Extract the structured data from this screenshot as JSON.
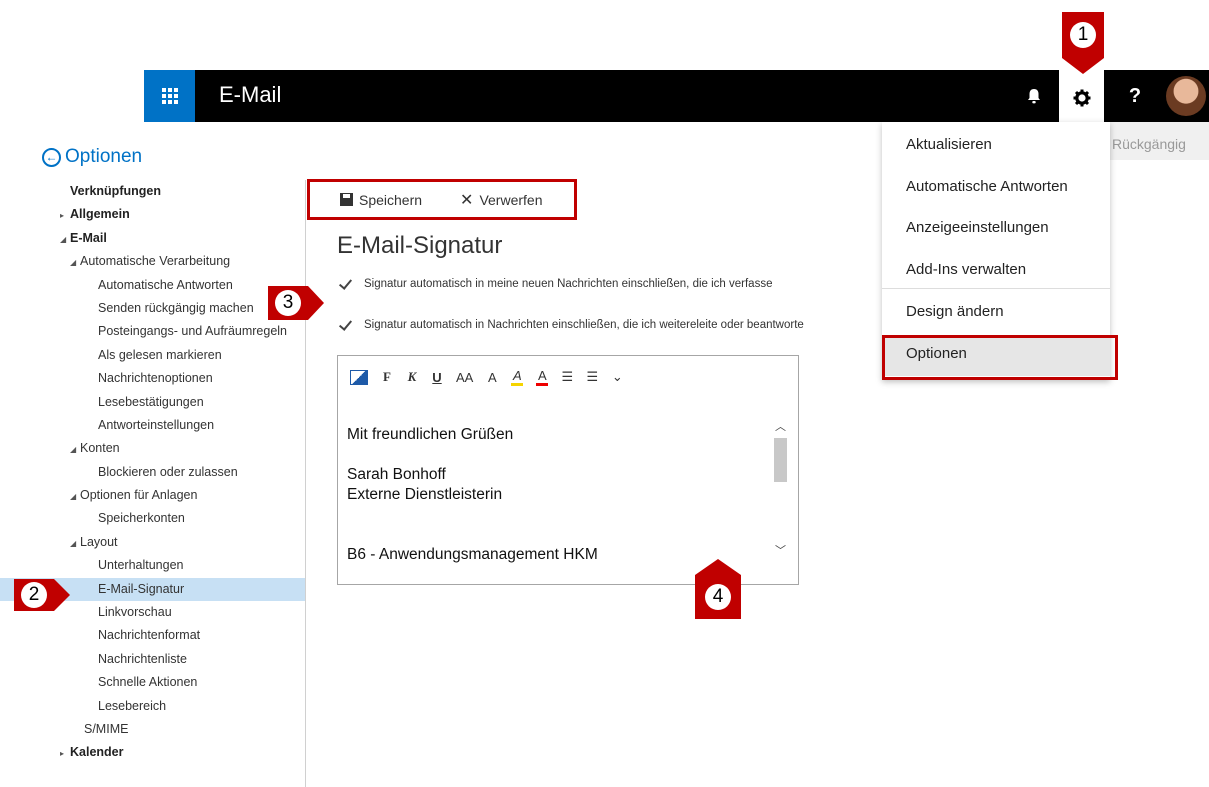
{
  "header": {
    "app_title": "E-Mail",
    "icons": [
      "app-launcher-icon",
      "bell-icon",
      "gear-icon",
      "help-icon",
      "avatar"
    ],
    "help_label": "?"
  },
  "nav": {
    "back_label": "Optionen",
    "items": [
      {
        "label": "Verknüpfungen",
        "level": 0,
        "bold": true,
        "arrow": ""
      },
      {
        "label": "Allgemein",
        "level": 0,
        "bold": true,
        "arrow": "▸"
      },
      {
        "label": "E-Mail",
        "level": 0,
        "bold": true,
        "arrow": "◢"
      },
      {
        "label": "Automatische Verarbeitung",
        "level": 1,
        "bold": false,
        "arrow": "◢"
      },
      {
        "label": "Automatische Antworten",
        "level": 2,
        "bold": false,
        "arrow": ""
      },
      {
        "label": "Senden rückgängig machen",
        "level": 2,
        "bold": false,
        "arrow": ""
      },
      {
        "label": "Posteingangs- und Aufräumregeln",
        "level": 2,
        "bold": false,
        "arrow": ""
      },
      {
        "label": "Als gelesen markieren",
        "level": 2,
        "bold": false,
        "arrow": ""
      },
      {
        "label": "Nachrichtenoptionen",
        "level": 2,
        "bold": false,
        "arrow": ""
      },
      {
        "label": "Lesebestätigungen",
        "level": 2,
        "bold": false,
        "arrow": ""
      },
      {
        "label": "Antworteinstellungen",
        "level": 2,
        "bold": false,
        "arrow": ""
      },
      {
        "label": "Konten",
        "level": 1,
        "bold": false,
        "arrow": "◢"
      },
      {
        "label": "Blockieren oder zulassen",
        "level": 2,
        "bold": false,
        "arrow": ""
      },
      {
        "label": "Optionen für Anlagen",
        "level": 1,
        "bold": false,
        "arrow": "◢"
      },
      {
        "label": "Speicherkonten",
        "level": 2,
        "bold": false,
        "arrow": ""
      },
      {
        "label": "Layout",
        "level": 1,
        "bold": false,
        "arrow": "◢"
      },
      {
        "label": "Unterhaltungen",
        "level": 2,
        "bold": false,
        "arrow": ""
      },
      {
        "label": "E-Mail-Signatur",
        "level": 2,
        "bold": false,
        "arrow": "",
        "selected": true
      },
      {
        "label": "Linkvorschau",
        "level": 2,
        "bold": false,
        "arrow": ""
      },
      {
        "label": "Nachrichtenformat",
        "level": 2,
        "bold": false,
        "arrow": ""
      },
      {
        "label": "Nachrichtenliste",
        "level": 2,
        "bold": false,
        "arrow": ""
      },
      {
        "label": "Schnelle Aktionen",
        "level": 2,
        "bold": false,
        "arrow": ""
      },
      {
        "label": "Lesebereich",
        "level": 2,
        "bold": false,
        "arrow": ""
      },
      {
        "label": "S/MIME",
        "level": 1,
        "bold": false,
        "arrow": ""
      },
      {
        "label": "Kalender",
        "level": 0,
        "bold": true,
        "arrow": "▸"
      }
    ]
  },
  "toolbar": {
    "save_label": "Speichern",
    "discard_label": "Verwerfen"
  },
  "content": {
    "title": "E-Mail-Signatur",
    "checkbox1": "Signatur automatisch in meine neuen Nachrichten einschließen, die ich verfasse",
    "checkbox2": "Signatur automatisch in Nachrichten einschließen, die ich weitereleite oder beantworte"
  },
  "format_bar": {
    "bold": "F",
    "italic": "K",
    "underline": "U",
    "font_size": "AA",
    "grow": "A",
    "highlight": "A",
    "color": "A",
    "bullets": "☰",
    "numbering": "☰",
    "more": "⌄"
  },
  "signature": {
    "line1": "Mit freundlichen Grüßen",
    "line2": "Sarah Bonhoff",
    "line3": "Externe Dienstleisterin",
    "line4": "B6 - Anwendungsmanagement HKM"
  },
  "settings_menu": {
    "refresh": "Aktualisieren",
    "auto_reply": "Automatische Antworten",
    "display": "Anzeigeeinstellungen",
    "addins": "Add-Ins verwalten",
    "theme": "Design ändern",
    "options": "Optionen"
  },
  "undo_label": "Rückgängig",
  "callouts": {
    "c1": "1",
    "c2": "2",
    "c3": "3",
    "c4": "4"
  },
  "colors": {
    "accent": "#0072c6",
    "callout": "#c00000",
    "selected": "#c7e0f4"
  }
}
